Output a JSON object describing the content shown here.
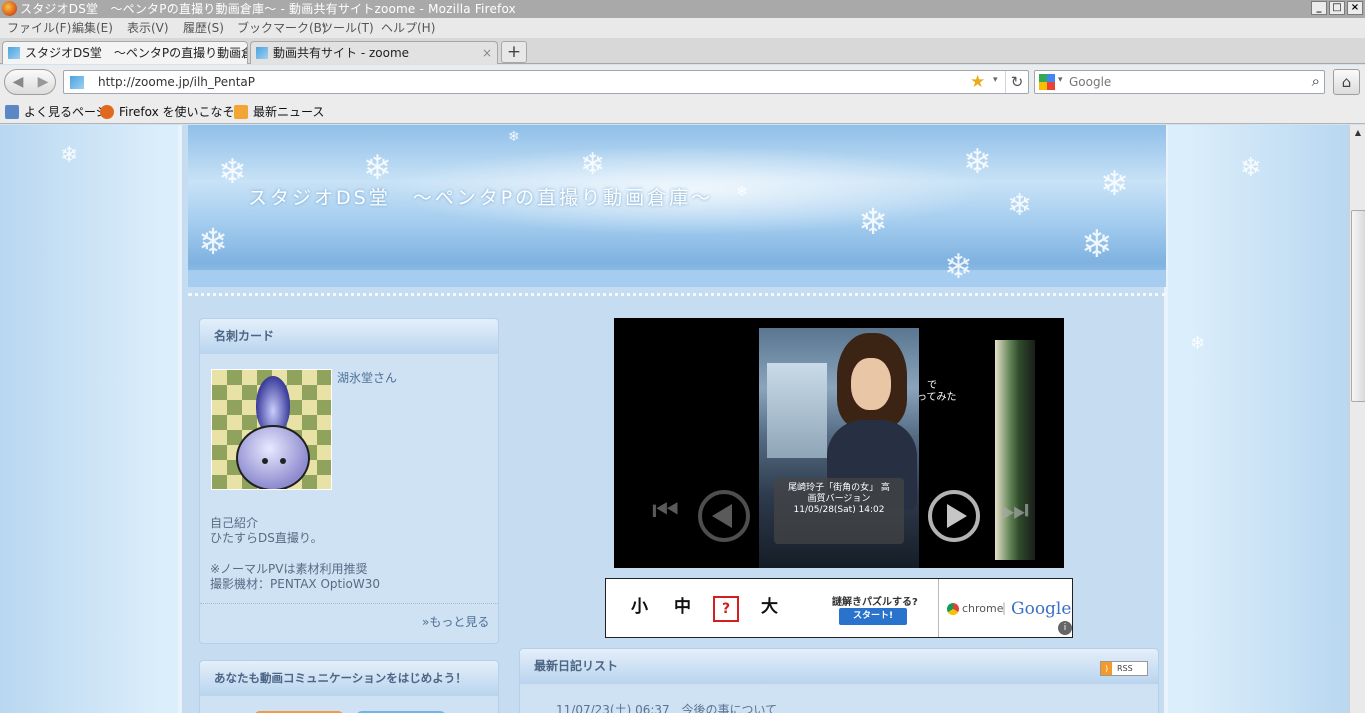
{
  "window": {
    "title": "スタジオDS堂　～ペンタPの直撮り動画倉庫～ - 動画共有サイトzoome - Mozilla Firefox",
    "controls": [
      "_",
      "□",
      "×"
    ]
  },
  "menu": [
    "ファイル(F)",
    "編集(E)",
    "表示(V)",
    "履歴(S)",
    "ブックマーク(B)",
    "ツール(T)",
    "ヘルプ(H)"
  ],
  "tabs": [
    {
      "label": "スタジオDS堂　～ペンタPの直撮り動画倉...",
      "close": "×",
      "active": true
    },
    {
      "label": "動画共有サイト - zoome",
      "close": "×",
      "active": false
    }
  ],
  "newtab_label": "+",
  "nav": {
    "back": "◀",
    "forward": "▶",
    "url": "http://zoome.jp/ilh_PentaP",
    "star": "★",
    "dropdown": "▾",
    "reload": "↻",
    "search_placeholder": "Google",
    "search_icon": "⌕",
    "home": "⌂"
  },
  "bookmarks": [
    {
      "label": "よく見るページ",
      "icon": "most-visited-icon",
      "color": "#5b87c4"
    },
    {
      "label": "Firefox を使いこなそう",
      "icon": "firefox-icon",
      "color": "#e0691f"
    },
    {
      "label": "最新ニュース",
      "icon": "rss-feed-icon",
      "color": "#f1a533"
    }
  ],
  "site": {
    "title": "スタジオDS堂　～ペンタPの直撮り動画倉庫～"
  },
  "card": {
    "heading": "名刺カード",
    "user": "湖氷堂さん",
    "intro_title": "自己紹介",
    "intro": "ひたすらDS直撮り。",
    "note1": "※ノーマルPVは素材利用推奨",
    "note2": "撮影機材：PENTAX OptioW30",
    "more": "»もっと見る"
  },
  "promo": {
    "heading": "あなたも動画コミュニケーションをはじめよう！"
  },
  "player": {
    "side_text_1": "で",
    "side_text_2": "ってみた",
    "caption_line1": "尾崎玲子「街角の女」 高",
    "caption_line2": "画質バージョン",
    "caption_date": "11/05/28(Sat) 14:02",
    "first_glyph": "⏮",
    "last_glyph": "⏭"
  },
  "ad": {
    "k1": "小",
    "k2": "中",
    "q": "?",
    "k3": "大",
    "quiz": "謎解きパズルする?",
    "start": "スタート!",
    "chrome": "chrome",
    "sep": "|",
    "google": "Google",
    "info": "i"
  },
  "diary": {
    "heading": "最新日記リスト",
    "rss_badge": "RSS",
    "rss_glyph": ")",
    "entries": [
      {
        "date": "11/07/23(土) 06:37",
        "title": "今後の事について"
      }
    ]
  }
}
